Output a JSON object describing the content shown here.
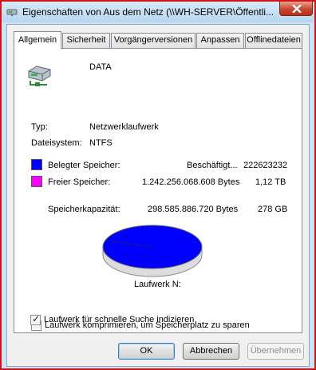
{
  "window": {
    "title": "Eigenschaften von Aus dem Netz (\\\\WH-SERVER\\Öffentli..."
  },
  "tabs": [
    {
      "label": "Allgemein",
      "active": true
    },
    {
      "label": "Sicherheit",
      "active": false
    },
    {
      "label": "Vorgängerversionen",
      "active": false
    },
    {
      "label": "Anpassen",
      "active": false
    },
    {
      "label": "Offlinedateien",
      "active": false
    }
  ],
  "general": {
    "drive_icon": "network-drive-icon",
    "drive_name": "DATA",
    "type_label": "Typ:",
    "type_value": "Netzwerklaufwerk",
    "filesystem_label": "Dateisystem:",
    "filesystem_value": "NTFS",
    "used": {
      "label": "Belegter Speicher:",
      "bytes": "Beschäftigt...",
      "size": "222623232",
      "color": "#0000ff"
    },
    "free": {
      "label": "Freier Speicher:",
      "bytes": "1.242.256.068.608 Bytes",
      "size": "1,12 TB",
      "color": "#ff00ff"
    },
    "capacity": {
      "label": "Speicherkapazität:",
      "bytes": "298.585.886.720 Bytes",
      "size": "278 GB"
    },
    "pie_label": "Laufwerk N:",
    "compress_label": "Laufwerk komprimieren, um Speicherplatz zu sparen",
    "compress_checked": false,
    "index_label": "Laufwerk für schnelle Suche indizieren",
    "index_checked": true
  },
  "buttons": {
    "ok": "OK",
    "cancel": "Abbrechen",
    "apply": "Übernehmen"
  }
}
